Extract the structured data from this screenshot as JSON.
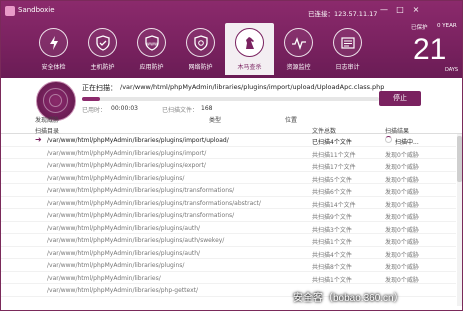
{
  "app": {
    "title": "Sandboxie",
    "ip_label": "已连接：123.57.11.17"
  },
  "window_controls": [
    "—",
    "□",
    "×"
  ],
  "toolbar": [
    {
      "label": "安全体检",
      "icon": "lightning-icon",
      "active": false
    },
    {
      "label": "主机防护",
      "icon": "shield-icon",
      "active": false
    },
    {
      "label": "应用防护",
      "icon": "web-shield-icon",
      "active": false
    },
    {
      "label": "网络防护",
      "icon": "network-shield-icon",
      "active": false
    },
    {
      "label": "木马查杀",
      "icon": "horse-icon",
      "active": true
    },
    {
      "label": "资源监控",
      "icon": "pulse-icon",
      "active": false
    },
    {
      "label": "日志审计",
      "icon": "log-icon",
      "active": false
    }
  ],
  "date": {
    "protect_label": "已保护",
    "days_label": "0 YEAR",
    "big": "21",
    "unit": "DAYS"
  },
  "scan": {
    "label": "正在扫描：",
    "path": "/var/www/html/phpMyAdmin/libraries/plugins/import/upload/UploadApc.class.php",
    "progress": 0.06,
    "time_label": "已用时：",
    "time_value": "00:00:03",
    "files_label": "已扫描文件：",
    "files_value": "168",
    "stop_label": "停止"
  },
  "threats": {
    "label": "发现威胁",
    "type_col": "类型",
    "pos_col": "位置"
  },
  "table": {
    "headers": {
      "dir": "扫描目录",
      "count": "文件总数",
      "result": "扫描结果"
    },
    "rows": [
      {
        "dir": "/var/www/html/phpMyAdmin/libraries/plugins/import/upload/",
        "count": "已扫描4个文件",
        "result": "扫描中...",
        "current": true
      },
      {
        "dir": "/var/www/html/phpMyAdmin/libraries/plugins/import/",
        "count": "共扫描11个文件",
        "result": "发现0个威胁"
      },
      {
        "dir": "/var/www/html/phpMyAdmin/libraries/plugins/export/",
        "count": "共扫描17个文件",
        "result": "发现0个威胁"
      },
      {
        "dir": "/var/www/html/phpMyAdmin/libraries/plugins/",
        "count": "共扫描5个文件",
        "result": "发现0个威胁"
      },
      {
        "dir": "/var/www/html/phpMyAdmin/libraries/plugins/transformations/",
        "count": "共扫描6个文件",
        "result": "发现0个威胁"
      },
      {
        "dir": "/var/www/html/phpMyAdmin/libraries/plugins/transformations/abstract/",
        "count": "共扫描14个文件",
        "result": "发现0个威胁"
      },
      {
        "dir": "/var/www/html/phpMyAdmin/libraries/plugins/transformations/",
        "count": "共扫描9个文件",
        "result": "发现0个威胁"
      },
      {
        "dir": "/var/www/html/phpMyAdmin/libraries/plugins/auth/",
        "count": "共扫描3个文件",
        "result": "发现0个威胁"
      },
      {
        "dir": "/var/www/html/phpMyAdmin/libraries/plugins/auth/swekey/",
        "count": "共扫描1个文件",
        "result": "发现0个威胁"
      },
      {
        "dir": "/var/www/html/phpMyAdmin/libraries/plugins/auth/",
        "count": "共扫描4个文件",
        "result": "发现0个威胁"
      },
      {
        "dir": "/var/www/html/phpMyAdmin/libraries/plugins/",
        "count": "共扫描8个文件",
        "result": "发现0个威胁"
      },
      {
        "dir": "/var/www/html/phpMyAdmin/libraries/",
        "count": "共扫描1个文件",
        "result": "发现0个威胁"
      },
      {
        "dir": "/var/www/html/phpMyAdmin/libraries/php-gettext/",
        "count": "",
        "result": ""
      }
    ]
  },
  "watermark": "安全客（bobao.360.cn）"
}
